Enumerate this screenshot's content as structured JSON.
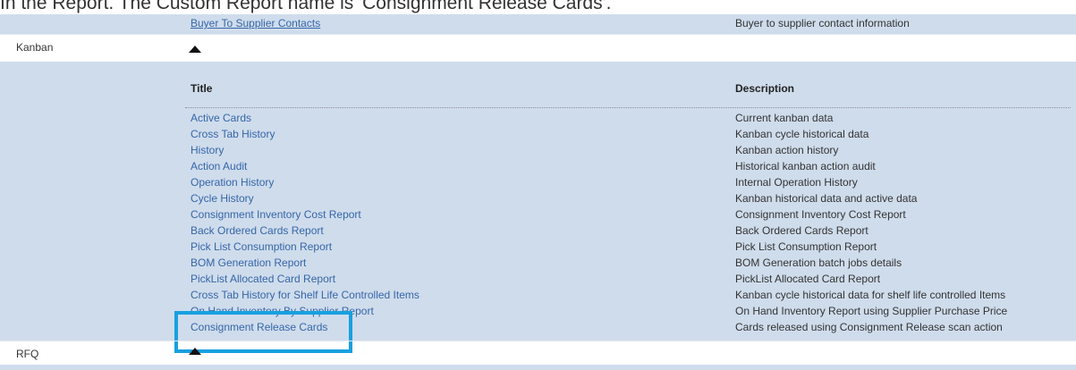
{
  "heading": "In the Report. The Custom Report name is 'Consignment Release Cards'.",
  "top_row": {
    "title": "Buyer To Supplier Contacts",
    "description": "Buyer to supplier contact information"
  },
  "kanban": {
    "label": "Kanban",
    "table": {
      "title_header": "Title",
      "description_header": "Description",
      "rows": [
        {
          "title": "Active Cards",
          "description": "Current kanban data"
        },
        {
          "title": "Cross Tab History",
          "description": "Kanban cycle historical data"
        },
        {
          "title": "History",
          "description": "Kanban action history"
        },
        {
          "title": "Action Audit",
          "description": "Historical kanban action audit"
        },
        {
          "title": "Operation History",
          "description": "Internal Operation History"
        },
        {
          "title": "Cycle History",
          "description": "Kanban historical data and active data"
        },
        {
          "title": "Consignment Inventory Cost Report",
          "description": "Consignment Inventory Cost Report"
        },
        {
          "title": "Back Ordered Cards Report",
          "description": "Back Ordered Cards Report"
        },
        {
          "title": "Pick List Consumption Report",
          "description": "Pick List Consumption Report"
        },
        {
          "title": "BOM Generation Report",
          "description": "BOM Generation batch jobs details"
        },
        {
          "title": "PickList Allocated Card Report",
          "description": "PickList Allocated Card Report"
        },
        {
          "title": "Cross Tab History for Shelf Life Controlled Items",
          "description": "Kanban cycle historical data for shelf life controlled Items"
        },
        {
          "title": "On Hand Inventory By Supplier Report",
          "description": "On Hand Inventory Report using Supplier Purchase Price"
        },
        {
          "title": "Consignment Release Cards",
          "description": "Cards released using Consignment Release scan action"
        }
      ]
    }
  },
  "rfq": {
    "label": "RFQ"
  },
  "colors": {
    "band": "#cfdcec",
    "link": "#3566a8",
    "highlight": "#18a0df"
  }
}
